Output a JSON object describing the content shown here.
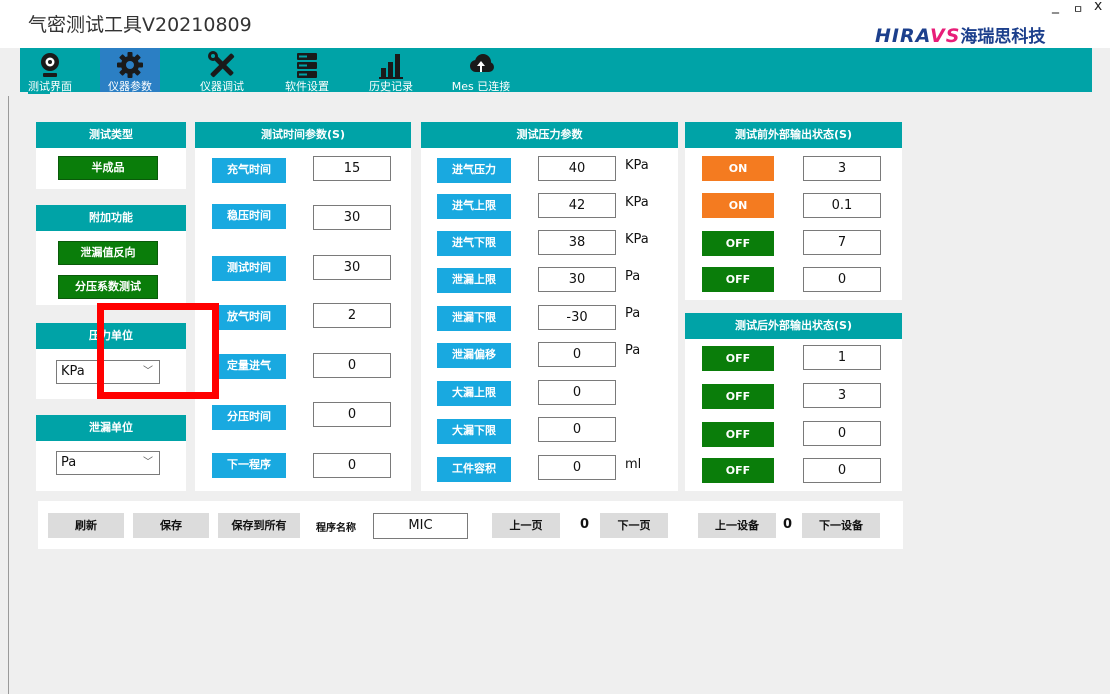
{
  "app": {
    "title": "气密测试工具V20210809",
    "window_controls": [
      "_",
      "ㅁ",
      "x"
    ]
  },
  "logo": {
    "brand_a": "HIRA",
    "brand_mark": "VS",
    "brand_cn": "海瑞思科技",
    "brand_color": "#1c3f8c",
    "accent_color": "#e81e78"
  },
  "toolbar": {
    "color": "#00a3a7",
    "items": [
      {
        "label": "测试界面",
        "icon": "camera-icon"
      },
      {
        "label": "仪器参数",
        "icon": "gear-icon",
        "active": true
      },
      {
        "label": "仪器调试",
        "icon": "tools-icon"
      },
      {
        "label": "软件设置",
        "icon": "server-icon"
      },
      {
        "label": "历史记录",
        "icon": "bar-chart-icon"
      },
      {
        "label": "Mes 已连接",
        "icon": "cloud-upload-icon"
      }
    ]
  },
  "test_type": {
    "header": "测试类型",
    "value": "半成品"
  },
  "extra": {
    "header": "附加功能",
    "buttons": [
      "泄漏值反向",
      "分压系数测试"
    ]
  },
  "pressure_unit": {
    "header": "压力单位",
    "value": "KPa"
  },
  "leak_unit": {
    "header": "泄漏单位",
    "value": "Pa"
  },
  "time_params": {
    "header": "测试时间参数(S)",
    "rows": [
      {
        "label": "充气时间",
        "value": "15"
      },
      {
        "label": "稳压时间",
        "value": "30"
      },
      {
        "label": "测试时间",
        "value": "30"
      },
      {
        "label": "放气时间",
        "value": "2"
      },
      {
        "label": "定量进气",
        "value": "0"
      },
      {
        "label": "分压时间",
        "value": "0"
      },
      {
        "label": "下一程序",
        "value": "0"
      }
    ]
  },
  "pressure_params": {
    "header": "测试压力参数",
    "rows": [
      {
        "label": "进气压力",
        "value": "40",
        "unit": "KPa"
      },
      {
        "label": "进气上限",
        "value": "42",
        "unit": "KPa"
      },
      {
        "label": "进气下限",
        "value": "38",
        "unit": "KPa"
      },
      {
        "label": "泄漏上限",
        "value": "30",
        "unit": "Pa"
      },
      {
        "label": "泄漏下限",
        "value": "-30",
        "unit": "Pa"
      },
      {
        "label": "泄漏偏移",
        "value": "0",
        "unit": "Pa"
      },
      {
        "label": "大漏上限",
        "value": "0",
        "unit": ""
      },
      {
        "label": "大漏下限",
        "value": "0",
        "unit": ""
      },
      {
        "label": "工件容积",
        "value": "0",
        "unit": "ml"
      }
    ]
  },
  "pre_output": {
    "header": "测试前外部输出状态(S)",
    "rows": [
      {
        "state": "ON",
        "value": "3"
      },
      {
        "state": "ON",
        "value": "0.1"
      },
      {
        "state": "OFF",
        "value": "7"
      },
      {
        "state": "OFF",
        "value": "0"
      }
    ]
  },
  "post_output": {
    "header": "测试后外部输出状态(S)",
    "rows": [
      {
        "state": "OFF",
        "value": "1"
      },
      {
        "state": "OFF",
        "value": "3"
      },
      {
        "state": "OFF",
        "value": "0"
      },
      {
        "state": "OFF",
        "value": "0"
      }
    ]
  },
  "bottom": {
    "refresh": "刷新",
    "save": "保存",
    "save_all": "保存到所有",
    "program_name_label": "程序名称",
    "program_name": "MIC",
    "prev_page": "上一页",
    "page_no": "0",
    "next_page": "下一页",
    "prev_device": "上一设备",
    "device_no": "0",
    "next_device": "下一设备"
  },
  "colors": {
    "teal": "#00a3a7",
    "blue": "#19a9e0",
    "green": "#0a7d0a",
    "orange": "#f47b20",
    "highlight": "#ff0000"
  }
}
